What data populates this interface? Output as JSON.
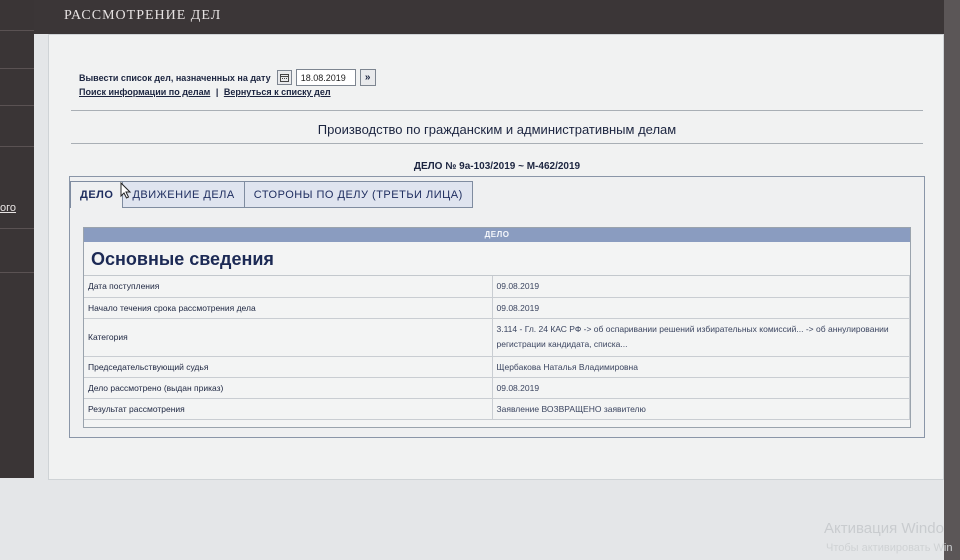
{
  "header": {
    "title": "РАССМОТРЕНИЕ ДЕЛ"
  },
  "sidebar": {
    "fragment": "ого"
  },
  "date_filter": {
    "label": "Вывести список дел, назначенных на дату",
    "date_value": "18.08.2019",
    "calendar_icon": "calendar-icon",
    "go_icon": "double-chevron-right-icon"
  },
  "links": {
    "search": "Поиск информации по делам",
    "separator": "|",
    "back": "Вернуться к списку дел"
  },
  "section_title": "Производство по гражданским и административным делам",
  "case_number": "ДЕЛО № 9а-103/2019 ~ М-462/2019",
  "tabs": [
    {
      "label": "ДЕЛО",
      "active": true
    },
    {
      "label": "ДВИЖЕНИЕ ДЕЛА",
      "active": false
    },
    {
      "label": "СТОРОНЫ ПО ДЕЛУ (ТРЕТЬИ ЛИЦА)",
      "active": false
    }
  ],
  "case": {
    "header": "ДЕЛО",
    "heading": "Основные сведения",
    "rows": [
      {
        "label": "Дата поступления",
        "value": "09.08.2019"
      },
      {
        "label": "Начало течения срока рассмотрения дела",
        "value": "09.08.2019"
      },
      {
        "label": "Категория",
        "value": "3.114 - Гл. 24 КАС РФ -> об оспаривании решений избирательных комиссий... -> об аннулировании регистрации кандидата, списка..."
      },
      {
        "label": "Председательствующий судья",
        "value": "Щербакова Наталья Владимировна"
      },
      {
        "label": "Дело рассмотрено (выдан приказ)",
        "value": "09.08.2019"
      },
      {
        "label": "Результат рассмотрения",
        "value": "Заявление ВОЗВРАЩЕНО заявителю"
      }
    ]
  },
  "watermark": {
    "line1": "Активация Windo",
    "line2": "Чтобы активировать Win"
  },
  "colors": {
    "header_bg": "#3b3637",
    "panel_bg": "#f1f2f2",
    "table_header_bg": "#8a9cc0",
    "text_navy": "#1c2540"
  }
}
